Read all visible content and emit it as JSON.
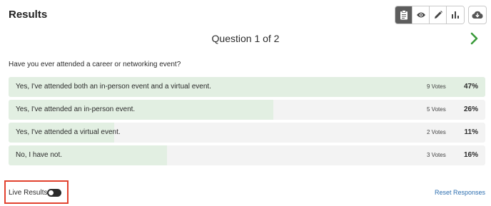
{
  "header": {
    "title": "Results",
    "toolbar": [
      {
        "icon": "clipboard-icon",
        "active": true
      },
      {
        "icon": "eye-icon",
        "active": false
      },
      {
        "icon": "pencil-icon",
        "active": false
      },
      {
        "icon": "bar-chart-icon",
        "active": false
      }
    ],
    "download_icon": "cloud-download-icon"
  },
  "question": {
    "heading": "Question 1 of 2",
    "text": "Have you ever attended a career or networking event?"
  },
  "answers": [
    {
      "label": "Yes, I've attended both an in-person event and a virtual event.",
      "votes": "9 Votes",
      "percent": "47%",
      "fill": 1.0
    },
    {
      "label": "Yes, I've attended an in-person event.",
      "votes": "5 Votes",
      "percent": "26%",
      "fill": 0.555
    },
    {
      "label": "Yes, I've attended a virtual event.",
      "votes": "2 Votes",
      "percent": "11%",
      "fill": 0.222
    },
    {
      "label": "No, I have not.",
      "votes": "3 Votes",
      "percent": "16%",
      "fill": 0.333
    }
  ],
  "footer": {
    "live_results_label": "Live Results",
    "live_results_on": false,
    "reset_label": "Reset Responses"
  },
  "colors": {
    "fill": "#e2efe2",
    "track": "#f3f3f3",
    "next_arrow": "#3a9a3a",
    "link": "#2e6fb0",
    "highlight": "#e2412e"
  }
}
